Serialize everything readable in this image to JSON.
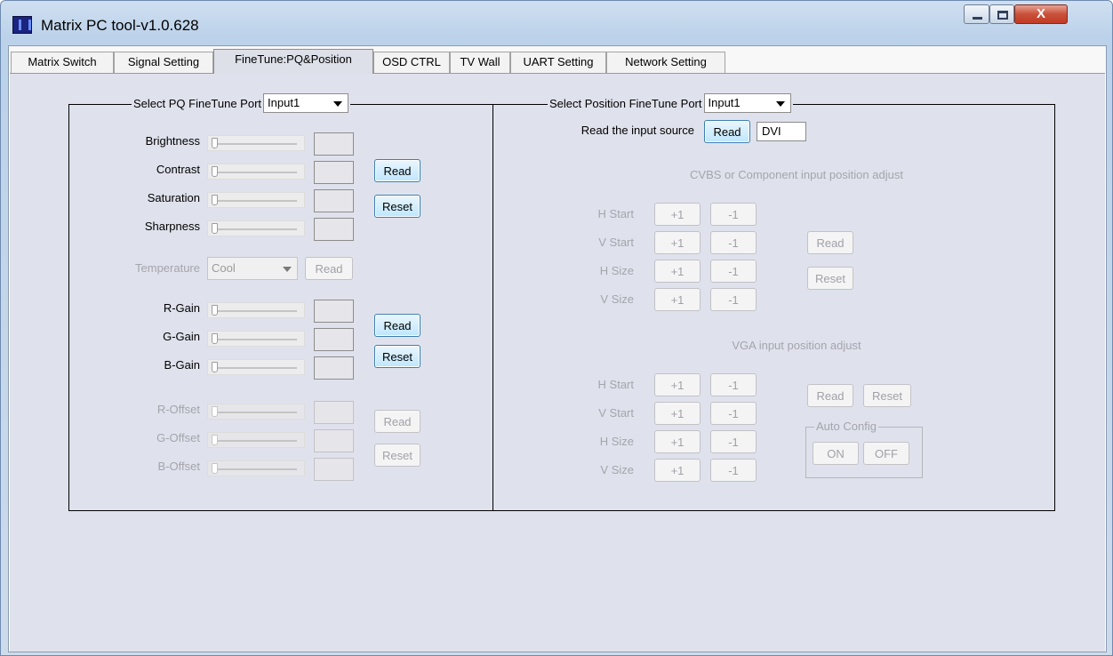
{
  "window": {
    "title": "Matrix PC tool-v1.0.628",
    "close_glyph": "X"
  },
  "tabs": [
    {
      "label": "Matrix Switch"
    },
    {
      "label": "Signal Setting"
    },
    {
      "label": "FineTune:PQ&Position"
    },
    {
      "label": "OSD CTRL"
    },
    {
      "label": "TV Wall"
    },
    {
      "label": "UART Setting"
    },
    {
      "label": "Network Setting"
    }
  ],
  "pq": {
    "legend_label": "Select PQ FineTune Port",
    "port_value": "Input1",
    "sliders": [
      {
        "label": "Brightness",
        "value": 0
      },
      {
        "label": "Contrast",
        "value": 0
      },
      {
        "label": "Saturation",
        "value": 0
      },
      {
        "label": "Sharpness",
        "value": 0
      },
      {
        "label": "R-Gain",
        "value": 0
      },
      {
        "label": "G-Gain",
        "value": 0
      },
      {
        "label": "B-Gain",
        "value": 0
      },
      {
        "label": "R-Offset",
        "value": 0
      },
      {
        "label": "G-Offset",
        "value": 0
      },
      {
        "label": "B-Offset",
        "value": 0
      }
    ],
    "read_label": "Read",
    "reset_label": "Reset",
    "temperature_label": "Temperature",
    "temperature_value": "Cool"
  },
  "position": {
    "legend_label": "Select Position FineTune Port",
    "port_value": "Input1",
    "read_source_label": "Read the input source",
    "read_label": "Read",
    "reset_label": "Reset",
    "source_value": "DVI",
    "cvbs_title": "CVBS or Component input position adjust",
    "vga_title": "VGA input position adjust",
    "rows": [
      "H Start",
      "V Start",
      "H Size",
      "V Size"
    ],
    "plus_label": "+1",
    "minus_label": "-1",
    "auto_config_label": "Auto Config",
    "on_label": "ON",
    "off_label": "OFF"
  }
}
